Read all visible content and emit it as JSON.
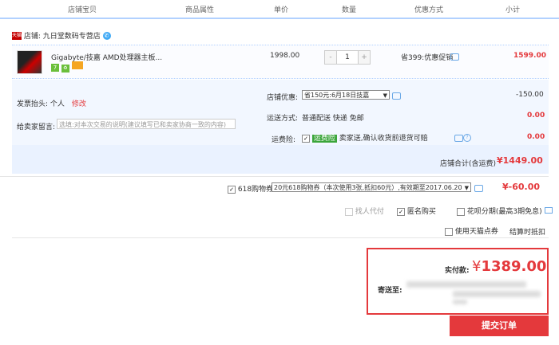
{
  "header": {
    "cols": [
      "店铺宝贝",
      "商品属性",
      "单价",
      "数量",
      "优惠方式",
      "小计"
    ]
  },
  "shop": {
    "badge": "天猫",
    "label": "店铺: 九日堂数码专营店"
  },
  "item": {
    "title": "Gigabyte/技嘉 AMD处理器主板...",
    "price": "1998.00",
    "qty": "1",
    "minus": "-",
    "plus": "+",
    "discount": "省399:优惠促销",
    "subtotal": "1599.00"
  },
  "invoice": {
    "label": "发票抬头:",
    "value": "个人",
    "edit": "修改"
  },
  "message": {
    "label": "给卖家留言:",
    "placeholder": "选填:对本次交易的说明(建议填写已和卖家协商一致的内容)"
  },
  "shop_discount": {
    "label": "店铺优惠:",
    "selected": "省150元:6月18日技嘉",
    "amount": "-150.00"
  },
  "shipping": {
    "label": "运送方式:",
    "value": "普通配送 快递 免邮",
    "amount": "0.00"
  },
  "insurance": {
    "label": "运费险:",
    "badge": "运费险",
    "text": "卖家送,确认收货前退货可赔",
    "amount": "0.00"
  },
  "shop_total": {
    "label": "店铺合计(含运费)",
    "amount": "¥1449.00"
  },
  "coupon": {
    "label": "618购物券",
    "selected": "20元618购物券（本次使用3张,抵扣60元）,有效期至2017.06.20",
    "amount": "¥-60.00"
  },
  "options": {
    "proxy": "找人代付",
    "anonymous": "匿名购买",
    "huabei": "花呗分期(最高3期免息)",
    "tmall_points": "使用天猫点券",
    "settle": "结算时抵扣"
  },
  "payment": {
    "label": "实付款:",
    "currency": "¥",
    "amount": "1389.00",
    "ship_to": "寄送至:"
  },
  "submit": "提交订单",
  "colors": {
    "accent": "#e4393c",
    "line": "#b2d1ff"
  }
}
